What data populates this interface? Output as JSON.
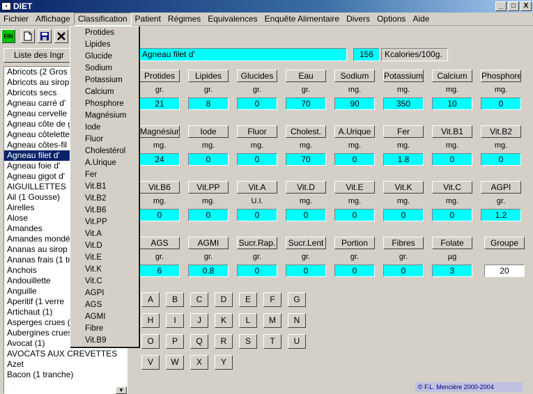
{
  "window": {
    "title": "DIET",
    "app_icon": "diet-app-icon",
    "min_label": "_",
    "max_label": "□",
    "close_label": "X"
  },
  "menu": [
    "Fichier",
    "Affichage",
    "Classification",
    "Patient",
    "Régimes",
    "Equivalences",
    "Enquête Alimentaire",
    "Divers",
    "Options",
    "Aide"
  ],
  "toolbar": {
    "fin_label": "FIN",
    "icons": [
      "new-document-icon",
      "save-disk-icon",
      "delete-x-icon"
    ]
  },
  "list": {
    "header": "Liste des Ingr",
    "selected_index": 9,
    "items": [
      "Abricots (2 Gros",
      "Abricots au sirop",
      "Abricots secs",
      "Agneau carré d'",
      "Agneau cervelle",
      "Agneau côte de g",
      "Agneau côtelette",
      "Agneau côtes-fil",
      "Agneau filet d'",
      "Agneau foie d'",
      "Agneau gigot d'",
      "AIGUILLETTES",
      "Ail (1 Gousse)",
      "Airelles",
      "Alose",
      "Amandes",
      "Amandes mondées",
      "Ananas au sirop (",
      "Ananas frais (1 tr",
      "Anchois",
      "Andouillette",
      "Anguille",
      "Aperitif (1 verre",
      "Artichaut (1)",
      "Asperges crues (1",
      "Aubergines crues",
      "Avocat (1)",
      "AVOCATS AUX CREVETTES",
      "Azet",
      "Bacon (1 tranche)"
    ],
    "scroll_down": "▼"
  },
  "classification_menu": [
    "Protides",
    "Lipides",
    "Glucide",
    "Sodium",
    "Potassium",
    "Calcium",
    "Phosphore",
    "Magnésium",
    "Iode",
    "Fluor",
    "Cholestérol",
    "A.Urique",
    "Fer",
    "Vit.B1",
    "Vit.B2",
    "Vit.B6",
    "Vit.PP",
    "Vit.A",
    "Vit.D",
    "Vit.E",
    "Vit.K",
    "Vit.C",
    "AGPI",
    "AGS",
    "AGMI",
    "Fibre",
    "Vit.B9"
  ],
  "food": {
    "name": "Agneau filet d'",
    "kcal": "156",
    "kcal_unit": "Kcalories/100g."
  },
  "nutrients": [
    [
      {
        "label": "Protides",
        "unit": "gr.",
        "value": "21"
      },
      {
        "label": "Lipides",
        "unit": "gr.",
        "value": "8"
      },
      {
        "label": "Glucides",
        "unit": "gr.",
        "value": "0"
      },
      {
        "label": "Eau",
        "unit": "gr.",
        "value": "70"
      },
      {
        "label": "Sodium",
        "unit": "mg.",
        "value": "90"
      },
      {
        "label": "Potassium",
        "unit": "mg.",
        "value": "350"
      },
      {
        "label": "Calcium",
        "unit": "mg.",
        "value": "10"
      },
      {
        "label": "Phosphore",
        "unit": "mg.",
        "value": "0"
      }
    ],
    [
      {
        "label": "Magnésium",
        "unit": "mg.",
        "value": "24"
      },
      {
        "label": "Iode",
        "unit": "mg.",
        "value": "0"
      },
      {
        "label": "Fluor",
        "unit": "mg.",
        "value": "0"
      },
      {
        "label": "Cholest.",
        "unit": "mg.",
        "value": "70"
      },
      {
        "label": "A.Urique",
        "unit": "mg.",
        "value": "0"
      },
      {
        "label": "Fer",
        "unit": "mg.",
        "value": "1.8"
      },
      {
        "label": "Vit.B1",
        "unit": "mg.",
        "value": "0"
      },
      {
        "label": "Vit.B2",
        "unit": "mg.",
        "value": "0"
      }
    ],
    [
      {
        "label": "Vit.B6",
        "unit": "mg.",
        "value": "0"
      },
      {
        "label": "Vit.PP",
        "unit": "mg.",
        "value": "0"
      },
      {
        "label": "Vit.A",
        "unit": "U.I.",
        "value": "0"
      },
      {
        "label": "Vit.D",
        "unit": "mg.",
        "value": "0"
      },
      {
        "label": "Vit.E",
        "unit": "mg.",
        "value": "0"
      },
      {
        "label": "Vit.K",
        "unit": "mg.",
        "value": "0"
      },
      {
        "label": "Vit.C",
        "unit": "mg.",
        "value": "0"
      },
      {
        "label": "AGPI",
        "unit": "gr.",
        "value": "1.2"
      }
    ],
    [
      {
        "label": "AGS",
        "unit": "gr.",
        "value": "6"
      },
      {
        "label": "AGMI",
        "unit": "gr.",
        "value": "0.8"
      },
      {
        "label": "Sucr.Rap.",
        "unit": "gr.",
        "value": "0"
      },
      {
        "label": "Sucr.Lent",
        "unit": "gr.",
        "value": "0"
      },
      {
        "label": "Portion",
        "unit": "gr.",
        "value": "0"
      },
      {
        "label": "Fibres",
        "unit": "gr.",
        "value": "0"
      },
      {
        "label": "Folate",
        "unit": "µg",
        "value": "3"
      },
      {
        "label": "Groupe",
        "unit": "",
        "value": "20"
      }
    ]
  ],
  "letters": [
    [
      "A",
      "B",
      "C",
      "D",
      "E",
      "F",
      "G"
    ],
    [
      "H",
      "I",
      "J",
      "K",
      "L",
      "M",
      "N"
    ],
    [
      "O",
      "P",
      "Q",
      "R",
      "S",
      "T",
      "U"
    ],
    [
      "V",
      "W",
      "X",
      "Y"
    ]
  ],
  "copyright": "© F.L. Mencière 2000-2004"
}
